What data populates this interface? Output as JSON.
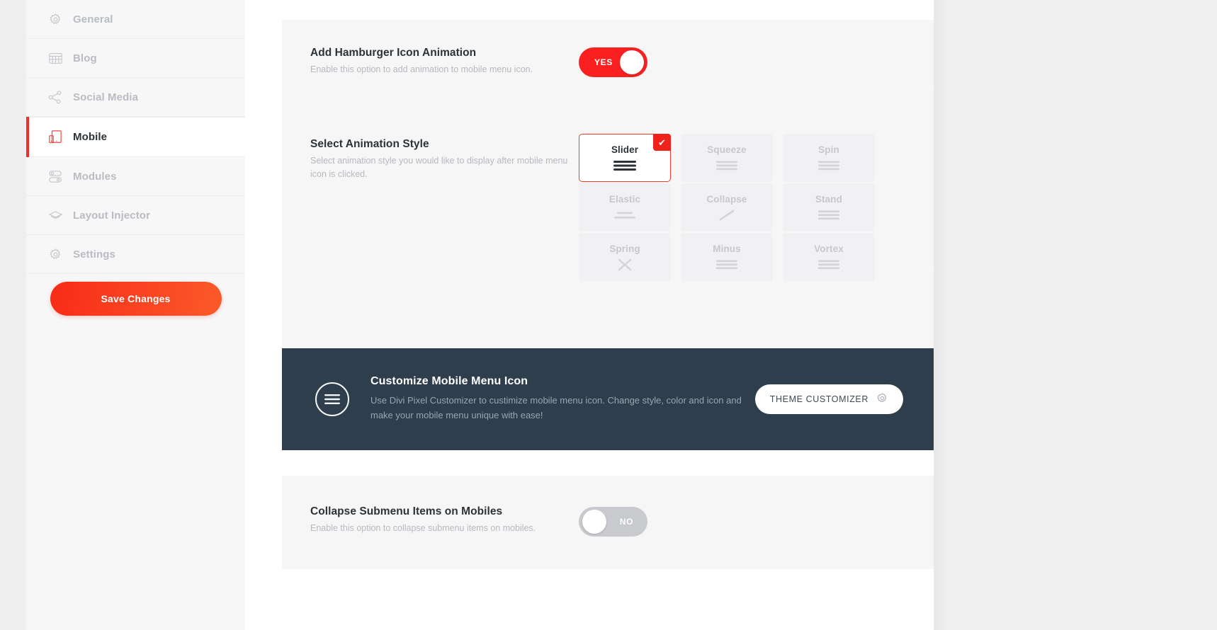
{
  "sidebar": {
    "items": [
      {
        "label": "General",
        "icon": "gear-icon",
        "active": false
      },
      {
        "label": "Blog",
        "icon": "blog-grid-icon",
        "active": false
      },
      {
        "label": "Social Media",
        "icon": "share-nodes-icon",
        "active": false
      },
      {
        "label": "Mobile",
        "icon": "mobile-device-icon",
        "active": true
      },
      {
        "label": "Modules",
        "icon": "modules-toggle-icon",
        "active": false
      },
      {
        "label": "Layout Injector",
        "icon": "layers-icon",
        "active": false
      },
      {
        "label": "Settings",
        "icon": "gear-icon",
        "active": false
      }
    ],
    "save_label": "Save Changes"
  },
  "options": {
    "hamburger": {
      "title": "Add Hamburger Icon Animation",
      "desc": "Enable this option to add animation to mobile menu icon.",
      "toggle_value": "YES",
      "toggle_state": "on"
    },
    "animation_style": {
      "title": "Select Animation Style",
      "desc": "Select animation style you would like to display after mobile menu icon is clicked.",
      "selected": "Slider",
      "tiles": [
        {
          "label": "Slider",
          "icon": "hamburger-3-bars-icon",
          "selected": true
        },
        {
          "label": "Squeeze",
          "icon": "hamburger-3-bars-icon",
          "selected": false
        },
        {
          "label": "Spin",
          "icon": "hamburger-3-bars-icon",
          "selected": false
        },
        {
          "label": "Elastic",
          "icon": "hamburger-2-bars-icon",
          "selected": false
        },
        {
          "label": "Collapse",
          "icon": "diagonal-line-icon",
          "selected": false
        },
        {
          "label": "Stand",
          "icon": "hamburger-3-bars-icon",
          "selected": false
        },
        {
          "label": "Spring",
          "icon": "close-x-icon",
          "selected": false
        },
        {
          "label": "Minus",
          "icon": "hamburger-3-bars-icon",
          "selected": false
        },
        {
          "label": "Vortex",
          "icon": "hamburger-3-bars-icon",
          "selected": false
        }
      ]
    },
    "collapse_submenu": {
      "title": "Collapse Submenu Items on Mobiles",
      "desc": "Enable this option to collapse submenu items on mobiles.",
      "toggle_value": "NO",
      "toggle_state": "off"
    }
  },
  "banner": {
    "icon": "hamburger-circle-icon",
    "title": "Customize Mobile Menu Icon",
    "desc": "Use Divi Pixel Customizer to custimize mobile menu icon. Change style, color and icon and make your mobile menu unique with ease!",
    "button_label": "THEME CUSTOMIZER",
    "button_icon": "gear-icon"
  },
  "colors": {
    "accent_red": "#fa2020",
    "save_gradient_start": "#f72c16",
    "save_gradient_end": "#fb5a2a",
    "banner_dark": "#2e3e4c",
    "sidebar_bg": "#f7f7f8",
    "card_bg": "#f6f6f7",
    "muted_text": "#b6b9bf",
    "title_text": "#2c3338"
  }
}
